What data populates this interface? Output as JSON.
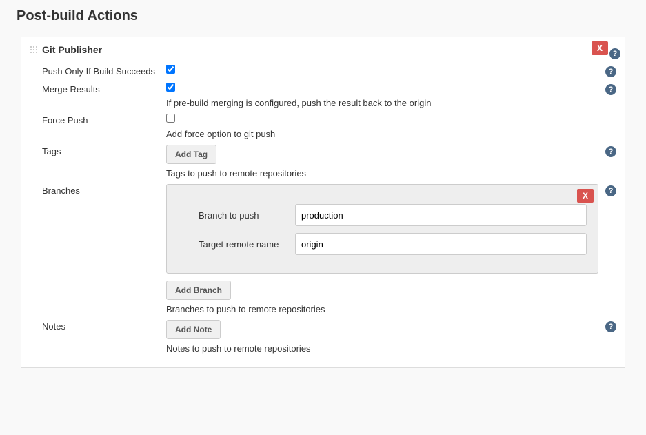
{
  "page": {
    "title": "Post-build Actions"
  },
  "section": {
    "title": "Git Publisher",
    "close": "X"
  },
  "fields": {
    "push_only": {
      "label": "Push Only If Build Succeeds",
      "checked": true,
      "desc": ""
    },
    "merge_results": {
      "label": "Merge Results",
      "checked": true,
      "desc": "If pre-build merging is configured, push the result back to the origin"
    },
    "force_push": {
      "label": "Force Push",
      "checked": false,
      "desc": "Add force option to git push"
    },
    "tags": {
      "label": "Tags",
      "button": "Add Tag",
      "desc": "Tags to push to remote repositories"
    },
    "branches": {
      "label": "Branches",
      "button": "Add Branch",
      "desc": "Branches to push to remote repositories",
      "close": "X",
      "sub": {
        "branch_label": "Branch to push",
        "branch_value": "production",
        "remote_label": "Target remote name",
        "remote_value": "origin"
      }
    },
    "notes": {
      "label": "Notes",
      "button": "Add Note",
      "desc": "Notes to push to remote repositories"
    }
  },
  "help": "?"
}
